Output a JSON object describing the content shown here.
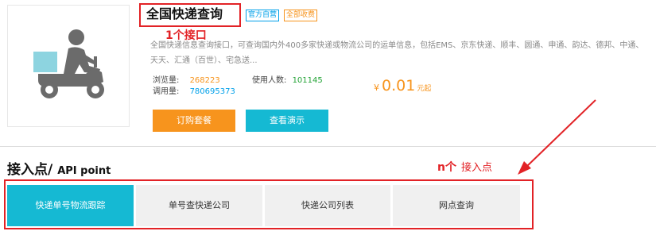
{
  "product": {
    "title": "全国快递查询",
    "badges": {
      "official": "官方自营",
      "charge": "全部收费"
    },
    "description": "全国快递信息查询接口，可查询国内外400多家快递或物流公司的运单信息，包括EMS、京东快递、顺丰、圆通、申通、韵达、德邦、中通、天天、汇通（百世）、宅急送...",
    "stats": {
      "views_label": "浏览量:",
      "views_value": "268223",
      "users_label": "使用人数:",
      "users_value": "101145",
      "calls_label": "调用量:",
      "calls_value": "780695373"
    },
    "price": {
      "currency": "¥",
      "amount": "0.01",
      "unit": "元起"
    },
    "buttons": {
      "order": "订购套餐",
      "demo": "查看演示"
    },
    "image_icon": "delivery-scooter-icon"
  },
  "annotations": {
    "one_interface": "1个接口",
    "n_prefix": "n个",
    "n_suffix": "接入点"
  },
  "api_section": {
    "title_cn": "接入点/",
    "title_en": "API point",
    "tabs": [
      {
        "label": "快递单号物流跟踪",
        "active": true
      },
      {
        "label": "单号查快递公司",
        "active": false
      },
      {
        "label": "快递公司列表",
        "active": false
      },
      {
        "label": "网点查询",
        "active": false
      }
    ]
  },
  "colors": {
    "accent_teal": "#15b9d3",
    "accent_orange": "#f7941d",
    "annotation_red": "#e22226",
    "badge_blue": "#00a0e9",
    "users_green": "#22a335"
  }
}
